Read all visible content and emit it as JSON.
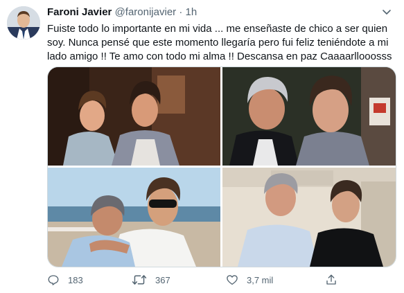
{
  "tweet": {
    "author_name": "Faroni Javier",
    "handle": "@faronijavier",
    "separator": "·",
    "time": "1h",
    "text_lines": [
      "Fuiste todo lo importante en mi vida ... me enseñaste de chico a ser quien",
      "soy. Nunca pensé que este momento llegaría pero fui feliz teniéndote a mi",
      "lado amigo !! Te amo con todo mi alma !! Descansa en paz Caaaarllooosss"
    ]
  },
  "actions": {
    "replies": "183",
    "retweets": "367",
    "likes": "3,7 mil"
  },
  "icons": {
    "more": "chevron-down-icon",
    "reply": "reply-icon",
    "retweet": "retweet-icon",
    "like": "heart-icon",
    "share": "share-icon"
  },
  "colors": {
    "text": "#0f1419",
    "muted": "#536471",
    "border": "#cfd9de"
  }
}
